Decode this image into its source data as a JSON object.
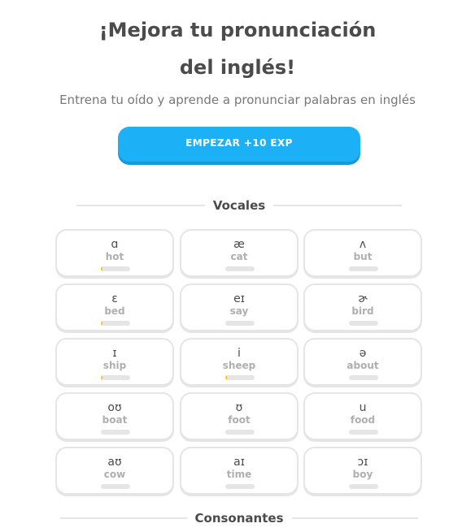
{
  "header": {
    "title": "¡Mejora tu pronunciación del inglés!",
    "subtitle": "Entrena tu oído y aprende a pronunciar palabras en inglés",
    "start_button": "EMPEZAR +10 EXP"
  },
  "sections": {
    "vowels": "Vocales",
    "consonants": "Consonantes"
  },
  "colors": {
    "button": "#1cb0f6",
    "progress": "#ffc800",
    "border": "#e5e5e5"
  },
  "sounds": [
    {
      "symbol": "ɑ",
      "word": "hot",
      "progress": 0.06
    },
    {
      "symbol": "æ",
      "word": "cat",
      "progress": 0
    },
    {
      "symbol": "ʌ",
      "word": "but",
      "progress": 0
    },
    {
      "symbol": "ɛ",
      "word": "bed",
      "progress": 0.06
    },
    {
      "symbol": "eɪ",
      "word": "say",
      "progress": 0
    },
    {
      "symbol": "ɚ",
      "word": "bird",
      "progress": 0
    },
    {
      "symbol": "ɪ",
      "word": "ship",
      "progress": 0.06
    },
    {
      "symbol": "i",
      "word": "sheep",
      "progress": 0.06
    },
    {
      "symbol": "ə",
      "word": "about",
      "progress": 0
    },
    {
      "symbol": "oʊ",
      "word": "boat",
      "progress": 0
    },
    {
      "symbol": "ʊ",
      "word": "foot",
      "progress": 0
    },
    {
      "symbol": "u",
      "word": "food",
      "progress": 0
    },
    {
      "symbol": "aʊ",
      "word": "cow",
      "progress": 0
    },
    {
      "symbol": "aɪ",
      "word": "time",
      "progress": 0
    },
    {
      "symbol": "ɔɪ",
      "word": "boy",
      "progress": 0
    }
  ]
}
